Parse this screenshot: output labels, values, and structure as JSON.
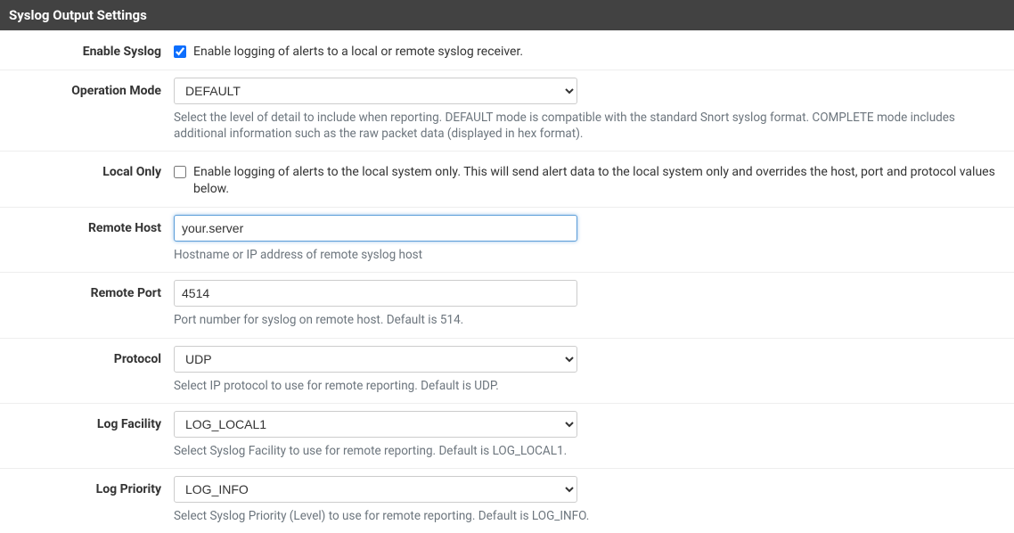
{
  "panel_title": "Syslog Output Settings",
  "rows": {
    "enable_syslog": {
      "label": "Enable Syslog",
      "checked": true,
      "text": "Enable logging of alerts to a local or remote syslog receiver."
    },
    "operation_mode": {
      "label": "Operation Mode",
      "value": "DEFAULT",
      "help": "Select the level of detail to include when reporting. DEFAULT mode is compatible with the standard Snort syslog format. COMPLETE mode includes additional information such as the raw packet data (displayed in hex format)."
    },
    "local_only": {
      "label": "Local Only",
      "checked": false,
      "text": "Enable logging of alerts to the local system only. This will send alert data to the local system only and overrides the host, port and protocol values below."
    },
    "remote_host": {
      "label": "Remote Host",
      "value": "your.server",
      "help": "Hostname or IP address of remote syslog host"
    },
    "remote_port": {
      "label": "Remote Port",
      "value": "4514",
      "help": "Port number for syslog on remote host. Default is 514."
    },
    "protocol": {
      "label": "Protocol",
      "value": "UDP",
      "help": "Select IP protocol to use for remote reporting. Default is UDP."
    },
    "log_facility": {
      "label": "Log Facility",
      "value": "LOG_LOCAL1",
      "help": "Select Syslog Facility to use for remote reporting. Default is LOG_LOCAL1."
    },
    "log_priority": {
      "label": "Log Priority",
      "value": "LOG_INFO",
      "help": "Select Syslog Priority (Level) to use for remote reporting. Default is LOG_INFO."
    }
  }
}
